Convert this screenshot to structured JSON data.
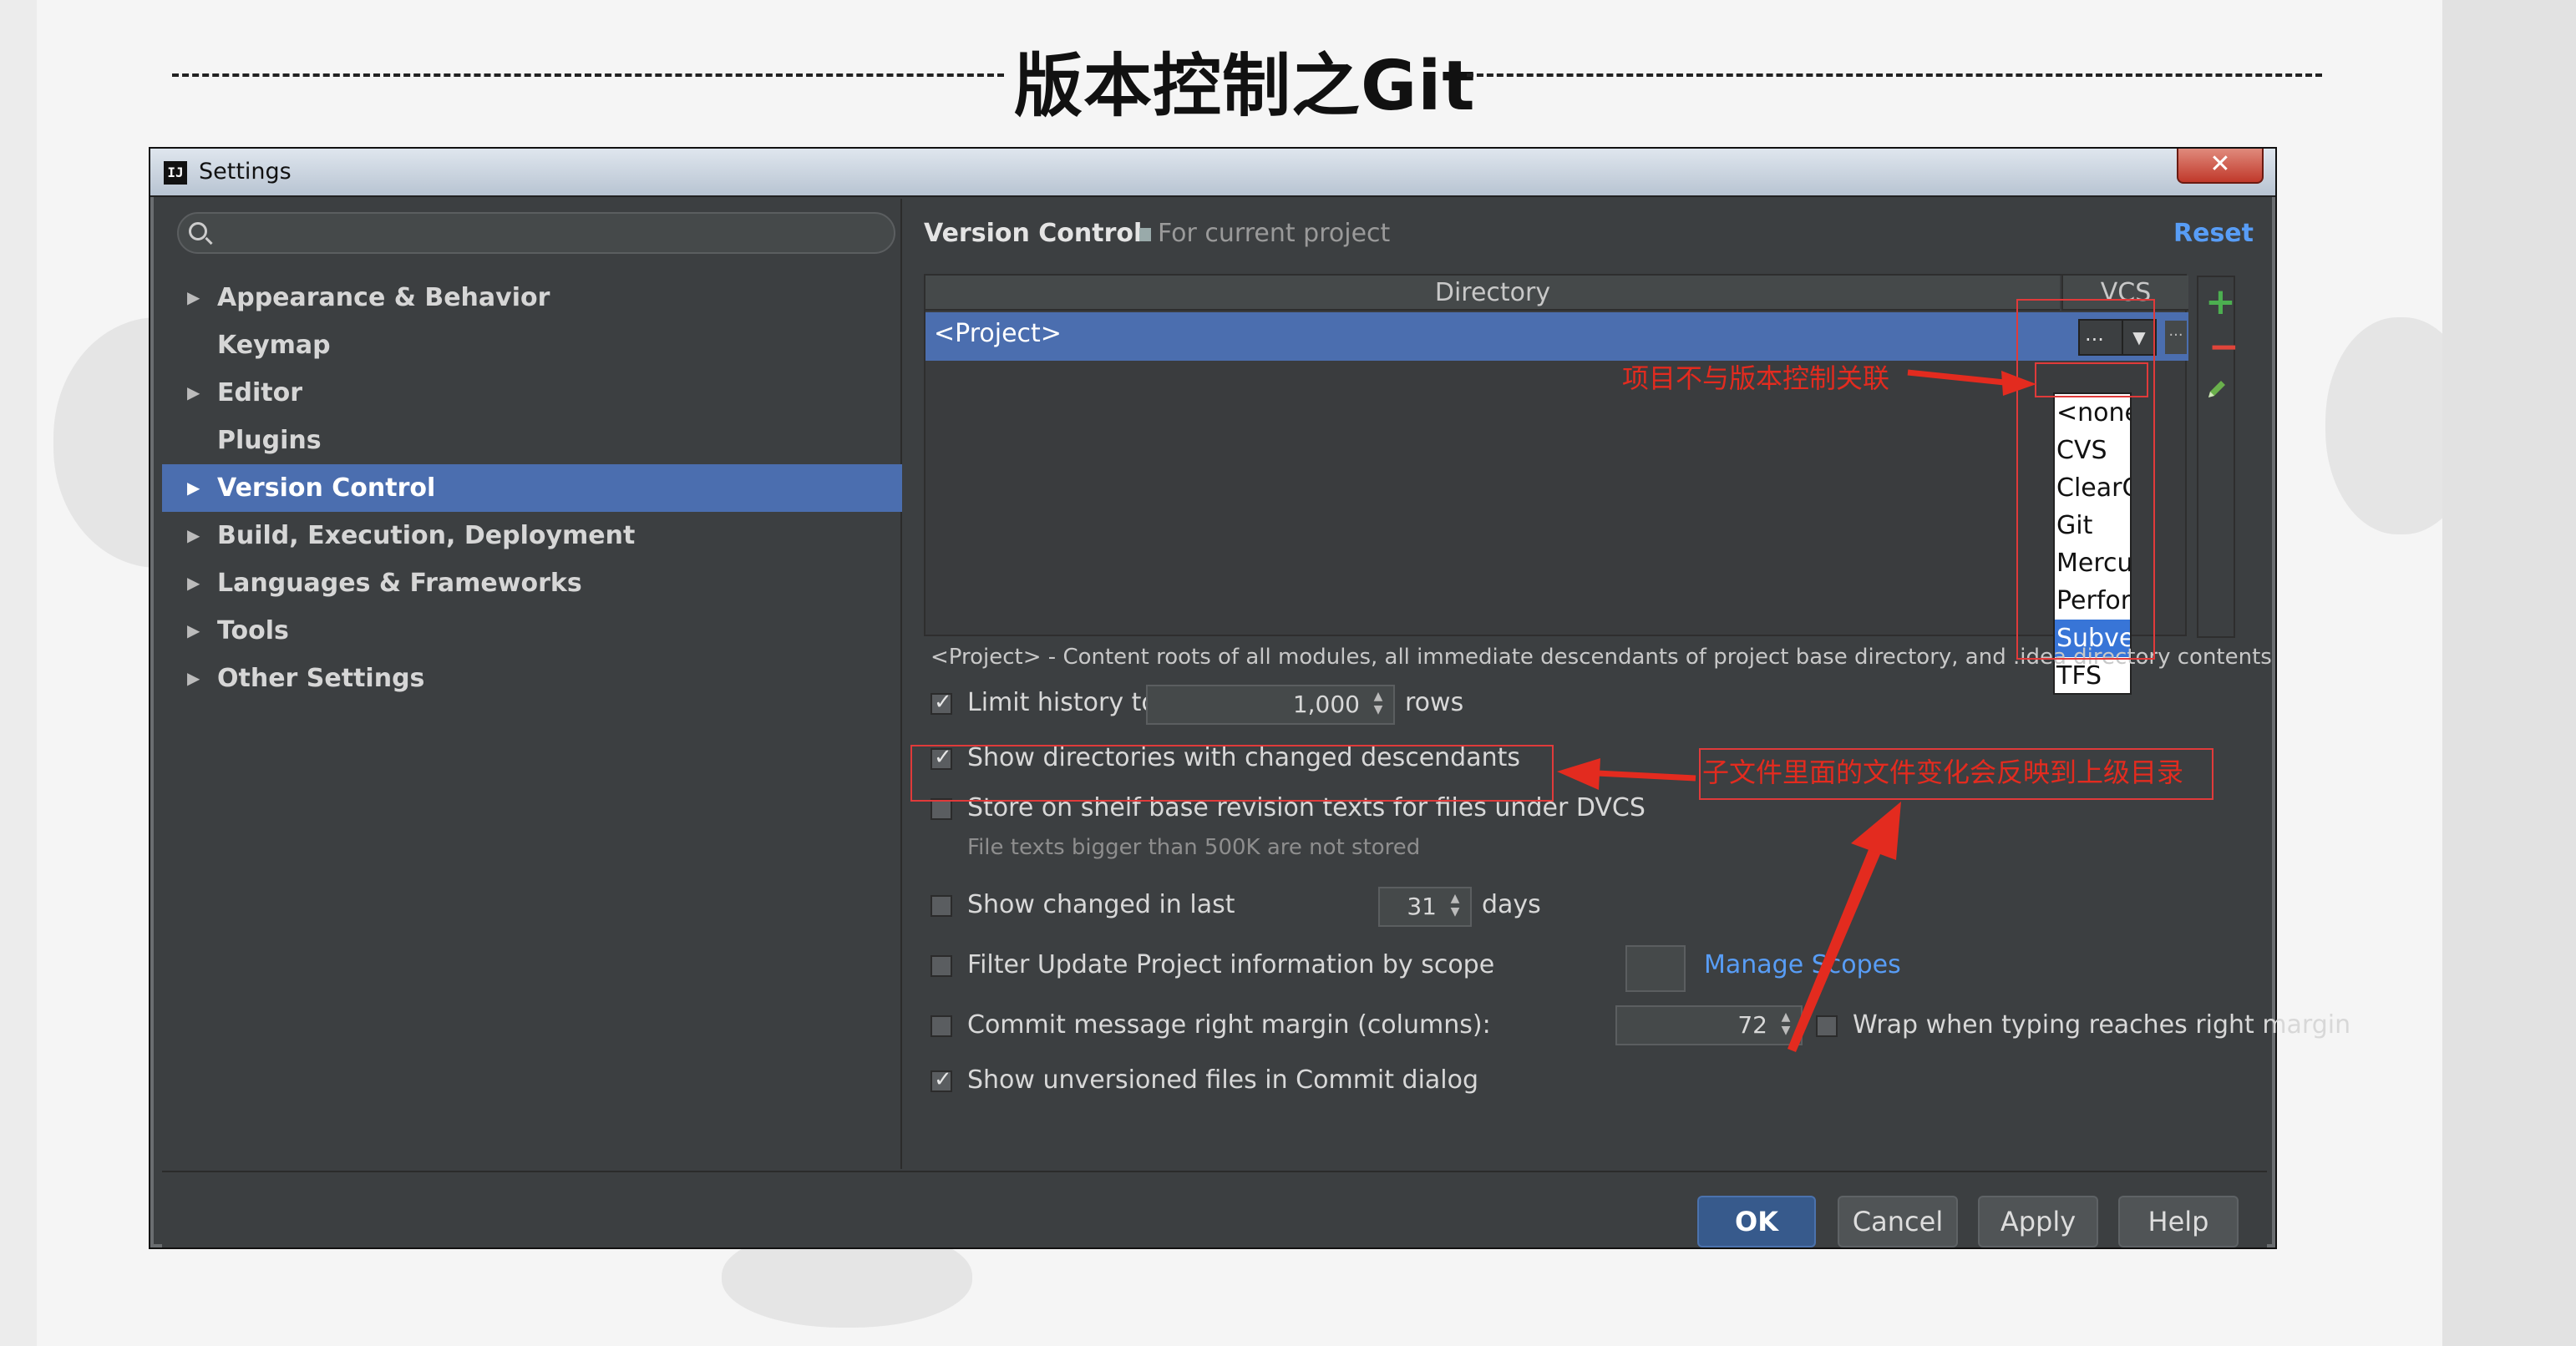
{
  "slide": {
    "title": "版本控制之Git"
  },
  "window": {
    "title": "Settings",
    "app_icon": "IJ",
    "close_glyph": "✕"
  },
  "sidebar": {
    "search": {
      "placeholder": ""
    },
    "items": [
      {
        "label": "Appearance & Behavior",
        "arrow": "▶"
      },
      {
        "label": "Keymap",
        "arrow": ""
      },
      {
        "label": "Editor",
        "arrow": "▶"
      },
      {
        "label": "Plugins",
        "arrow": ""
      },
      {
        "label": "Version Control",
        "arrow": "▶"
      },
      {
        "label": "Build, Execution, Deployment",
        "arrow": "▶"
      },
      {
        "label": "Languages & Frameworks",
        "arrow": "▶"
      },
      {
        "label": "Tools",
        "arrow": "▶"
      },
      {
        "label": "Other Settings",
        "arrow": "▶"
      }
    ],
    "selected": "Version Control"
  },
  "content": {
    "title": "Version Control",
    "subtitle": "For current project",
    "reset_label": "Reset",
    "table": {
      "headers": {
        "directory": "Directory",
        "vcs": "VCS"
      },
      "rows": [
        {
          "directory": "<Project>",
          "vcs": "..."
        }
      ]
    },
    "tools": {
      "add": "+",
      "remove": "−"
    },
    "vcs_dropdown": {
      "options": [
        "<none>",
        "CVS",
        "ClearC",
        "Git",
        "Mercu",
        "Perfor",
        "Subver",
        "TFS"
      ],
      "highlighted": "Subver"
    },
    "hint": "<Project> - Content roots of all modules, all immediate descendants of project base directory, and .idea directory contents",
    "options": {
      "limit_history": {
        "label": "Limit history to:",
        "value": "1,000",
        "suffix": "rows",
        "checked": true
      },
      "show_changed_dirs": {
        "label": "Show directories with changed descendants",
        "checked": true
      },
      "store_shelf": {
        "label": "Store on shelf base revision texts for files under DVCS",
        "note": "File texts bigger than 500K are not stored",
        "checked": false
      },
      "show_changed_last": {
        "label": "Show changed in last",
        "value": "31",
        "suffix": "days",
        "checked": false
      },
      "filter_update": {
        "label": "Filter Update Project information by scope",
        "link": "Manage Scopes",
        "checked": false
      },
      "commit_margin": {
        "label": "Commit message right margin (columns):",
        "value": "72",
        "checked": false
      },
      "wrap_typing": {
        "label": "Wrap when typing reaches right margin",
        "checked": false
      },
      "show_unversioned": {
        "label": "Show unversioned files in Commit dialog",
        "checked": true
      }
    }
  },
  "annotations": {
    "none_note": "项目不与版本控制关联",
    "dirs_note": "子文件里面的文件变化会反映到上级目录"
  },
  "footer": {
    "ok": "OK",
    "cancel": "Cancel",
    "apply": "Apply",
    "help": "Help"
  },
  "colors": {
    "accent": "#4b6eaf",
    "annotation_red": "#e32b1f",
    "link": "#589df6"
  }
}
